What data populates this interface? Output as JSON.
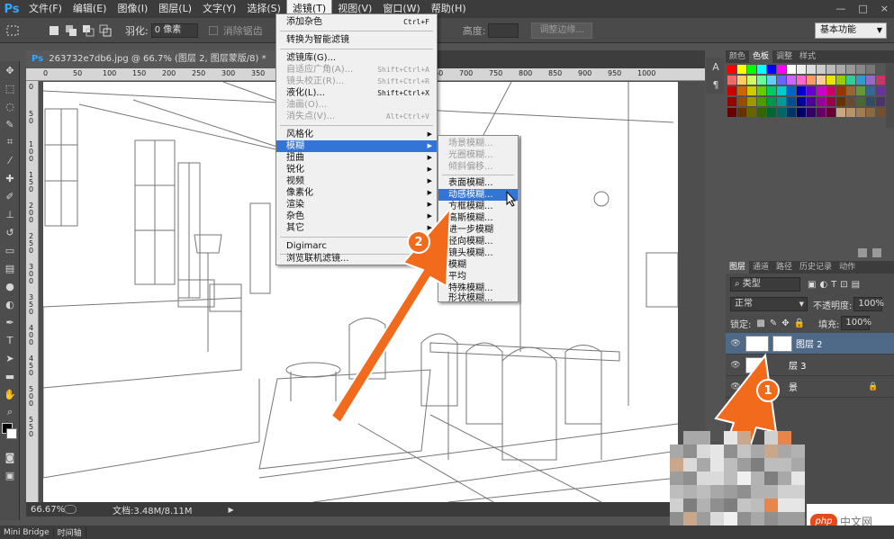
{
  "app": {
    "logo": "Ps"
  },
  "menubar": {
    "items": [
      "文件(F)",
      "编辑(E)",
      "图像(I)",
      "图层(L)",
      "文字(Y)",
      "选择(S)",
      "滤镜(T)",
      "视图(V)",
      "窗口(W)",
      "帮助(H)"
    ],
    "active": "滤镜(T)"
  },
  "window_controls": {
    "minimize": "—",
    "maximize": "□",
    "close": "×"
  },
  "options_bar": {
    "feather_label": "羽化:",
    "feather_value": "0 像素",
    "antialias_label": "消除锯齿",
    "style_label": "样式",
    "height_label": "高度:",
    "refine_button": "调整边缘...",
    "workspace": "基本功能"
  },
  "document": {
    "tab_title": "263732e7db6.jpg @ 66.7% (图层 2, 图层蒙版/8) *",
    "zoom": "66.67%",
    "doc_size": "文档:3.48M/8.11M",
    "ruler_h": [
      "0",
      "50",
      "100",
      "150",
      "200",
      "250",
      "300",
      "350",
      "400",
      "450",
      "500",
      "550",
      "600",
      "650",
      "700",
      "750",
      "800",
      "850",
      "900",
      "950",
      "1000"
    ],
    "ruler_v": [
      "0",
      "5",
      "0",
      "1",
      "0",
      "0",
      "1",
      "5",
      "0",
      "2",
      "0",
      "0",
      "2",
      "5",
      "0",
      "3",
      "0",
      "0",
      "3",
      "5",
      "0",
      "4",
      "0",
      "0",
      "4",
      "5",
      "0",
      "5",
      "0",
      "0",
      "5",
      "5",
      "0"
    ]
  },
  "filter_menu": {
    "items": [
      {
        "label": "添加杂色",
        "shortcut": "Ctrl+F"
      },
      {
        "label": "转换为智能滤镜"
      },
      {
        "label": "滤镜库(G)..."
      },
      {
        "label": "自适应广角(A)...",
        "shortcut": "Shift+Ctrl+A",
        "disabled": true
      },
      {
        "label": "镜头校正(R)...",
        "shortcut": "Shift+Ctrl+R",
        "disabled": true
      },
      {
        "label": "液化(L)...",
        "shortcut": "Shift+Ctrl+X"
      },
      {
        "label": "油画(O)...",
        "disabled": true
      },
      {
        "label": "消失点(V)...",
        "shortcut": "Alt+Ctrl+V",
        "disabled": true
      },
      {
        "label": "风格化"
      },
      {
        "label": "模糊"
      },
      {
        "label": "扭曲"
      },
      {
        "label": "锐化"
      },
      {
        "label": "视频"
      },
      {
        "label": "像素化"
      },
      {
        "label": "渲染"
      },
      {
        "label": "杂色"
      },
      {
        "label": "其它"
      },
      {
        "label": "Digimarc"
      },
      {
        "label": "浏览联机滤镜..."
      }
    ]
  },
  "blur_submenu": {
    "items": [
      {
        "label": "场景模糊...",
        "disabled": true
      },
      {
        "label": "光圈模糊...",
        "disabled": true
      },
      {
        "label": "倾斜偏移...",
        "disabled": true
      },
      {
        "label": "表面模糊..."
      },
      {
        "label": "动感模糊..."
      },
      {
        "label": "方框模糊..."
      },
      {
        "label": "高斯模糊..."
      },
      {
        "label": "进一步模糊"
      },
      {
        "label": "径向模糊..."
      },
      {
        "label": "镜头模糊..."
      },
      {
        "label": "模糊"
      },
      {
        "label": "平均"
      },
      {
        "label": "特殊模糊..."
      },
      {
        "label": "形状模糊..."
      }
    ]
  },
  "color_panel": {
    "tabs": [
      "颜色",
      "色板",
      "调整",
      "样式"
    ],
    "active": "色板"
  },
  "layers_panel": {
    "tabs": [
      "图层",
      "通道",
      "路径",
      "历史记录",
      "动作"
    ],
    "active": "图层",
    "kind_filter": "类型",
    "blend_mode": "正常",
    "opacity_label": "不透明度:",
    "opacity": "100%",
    "lock_label": "锁定:",
    "fill_label": "填充:",
    "fill": "100%",
    "layers": [
      {
        "name": "图层 2",
        "selected": true
      },
      {
        "name": "层 3",
        "selected": false
      },
      {
        "name": "景",
        "selected": false
      }
    ]
  },
  "bottom_tabs": [
    "Mini Bridge",
    "时间轴"
  ],
  "annotations": {
    "step1": "1",
    "step2": "2",
    "arrow_color": "#f26b1d"
  },
  "watermark": {
    "logo": "php",
    "text": "中文网"
  }
}
